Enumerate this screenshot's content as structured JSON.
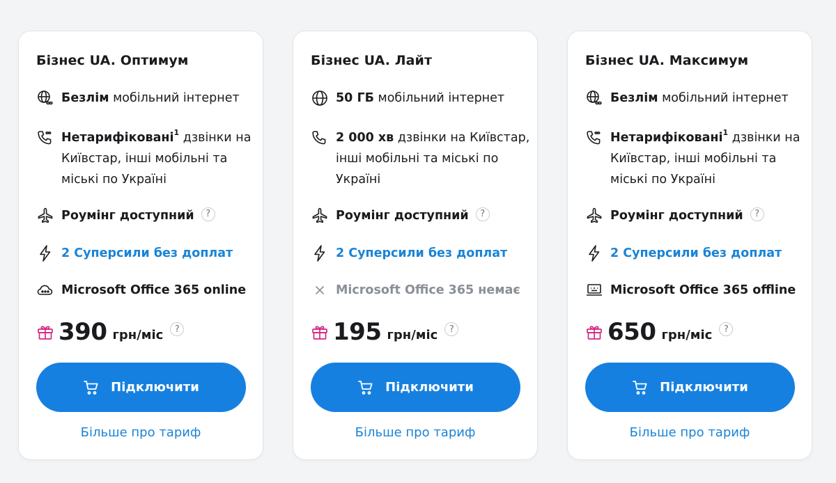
{
  "colors": {
    "accent": "#1680e0",
    "link": "#1a84d6",
    "gift": "#d6267f",
    "muted": "#8a8f98"
  },
  "plans": [
    {
      "title": "Бізнес UA. Оптимум",
      "internet": {
        "bold": "Безлім",
        "rest": " мобільний інтернет",
        "icon": "globe-infinity-icon"
      },
      "calls": {
        "bold": "Нетарифіковані",
        "sup": "1",
        "rest": " дзвінки на Київстар, інші мобільні та міські по Україні",
        "icon": "phone-infinity-icon"
      },
      "roaming": {
        "text": "Роумінг доступний",
        "help": "?",
        "icon": "airplane-icon"
      },
      "superpowers": {
        "text": "2 Суперсили без доплат",
        "icon": "lightning-icon"
      },
      "office": {
        "text": "Microsoft Office 365 online",
        "icon": "cloud-icon"
      },
      "price": {
        "amount": "390",
        "unit": "грн/міс",
        "help": "?"
      },
      "connect_label": "Підключити",
      "more_label": "Більше про тариф"
    },
    {
      "title": "Бізнес UA. Лайт",
      "internet": {
        "bold": "50 ГБ",
        "rest": " мобільний інтернет",
        "icon": "globe-icon"
      },
      "calls": {
        "bold": "2 000 хв",
        "sup": "",
        "rest": " дзвінки на Київстар, інші мобільні та міські по Україні",
        "icon": "phone-icon"
      },
      "roaming": {
        "text": "Роумінг доступний",
        "help": "?",
        "icon": "airplane-icon"
      },
      "superpowers": {
        "text": "2 Суперсили без доплат",
        "icon": "lightning-icon"
      },
      "office": {
        "text": "Microsoft Office 365 немає",
        "icon": "close-icon"
      },
      "price": {
        "amount": "195",
        "unit": "грн/міс",
        "help": "?"
      },
      "connect_label": "Підключити",
      "more_label": "Більше про тариф"
    },
    {
      "title": "Бізнес UA. Максимум",
      "internet": {
        "bold": "Безлім",
        "rest": " мобільний інтернет",
        "icon": "globe-infinity-icon"
      },
      "calls": {
        "bold": "Нетарифіковані",
        "sup": "1",
        "rest": " дзвінки на Київстар, інші мобільні та міські по Україні",
        "icon": "phone-infinity-icon"
      },
      "roaming": {
        "text": "Роумінг доступний",
        "help": "?",
        "icon": "airplane-icon"
      },
      "superpowers": {
        "text": "2 Суперсили без доплат",
        "icon": "lightning-icon"
      },
      "office": {
        "text": "Microsoft Office 365 offline",
        "icon": "laptop-icon"
      },
      "price": {
        "amount": "650",
        "unit": "грн/міс",
        "help": "?"
      },
      "connect_label": "Підключити",
      "more_label": "Більше про тариф"
    }
  ]
}
